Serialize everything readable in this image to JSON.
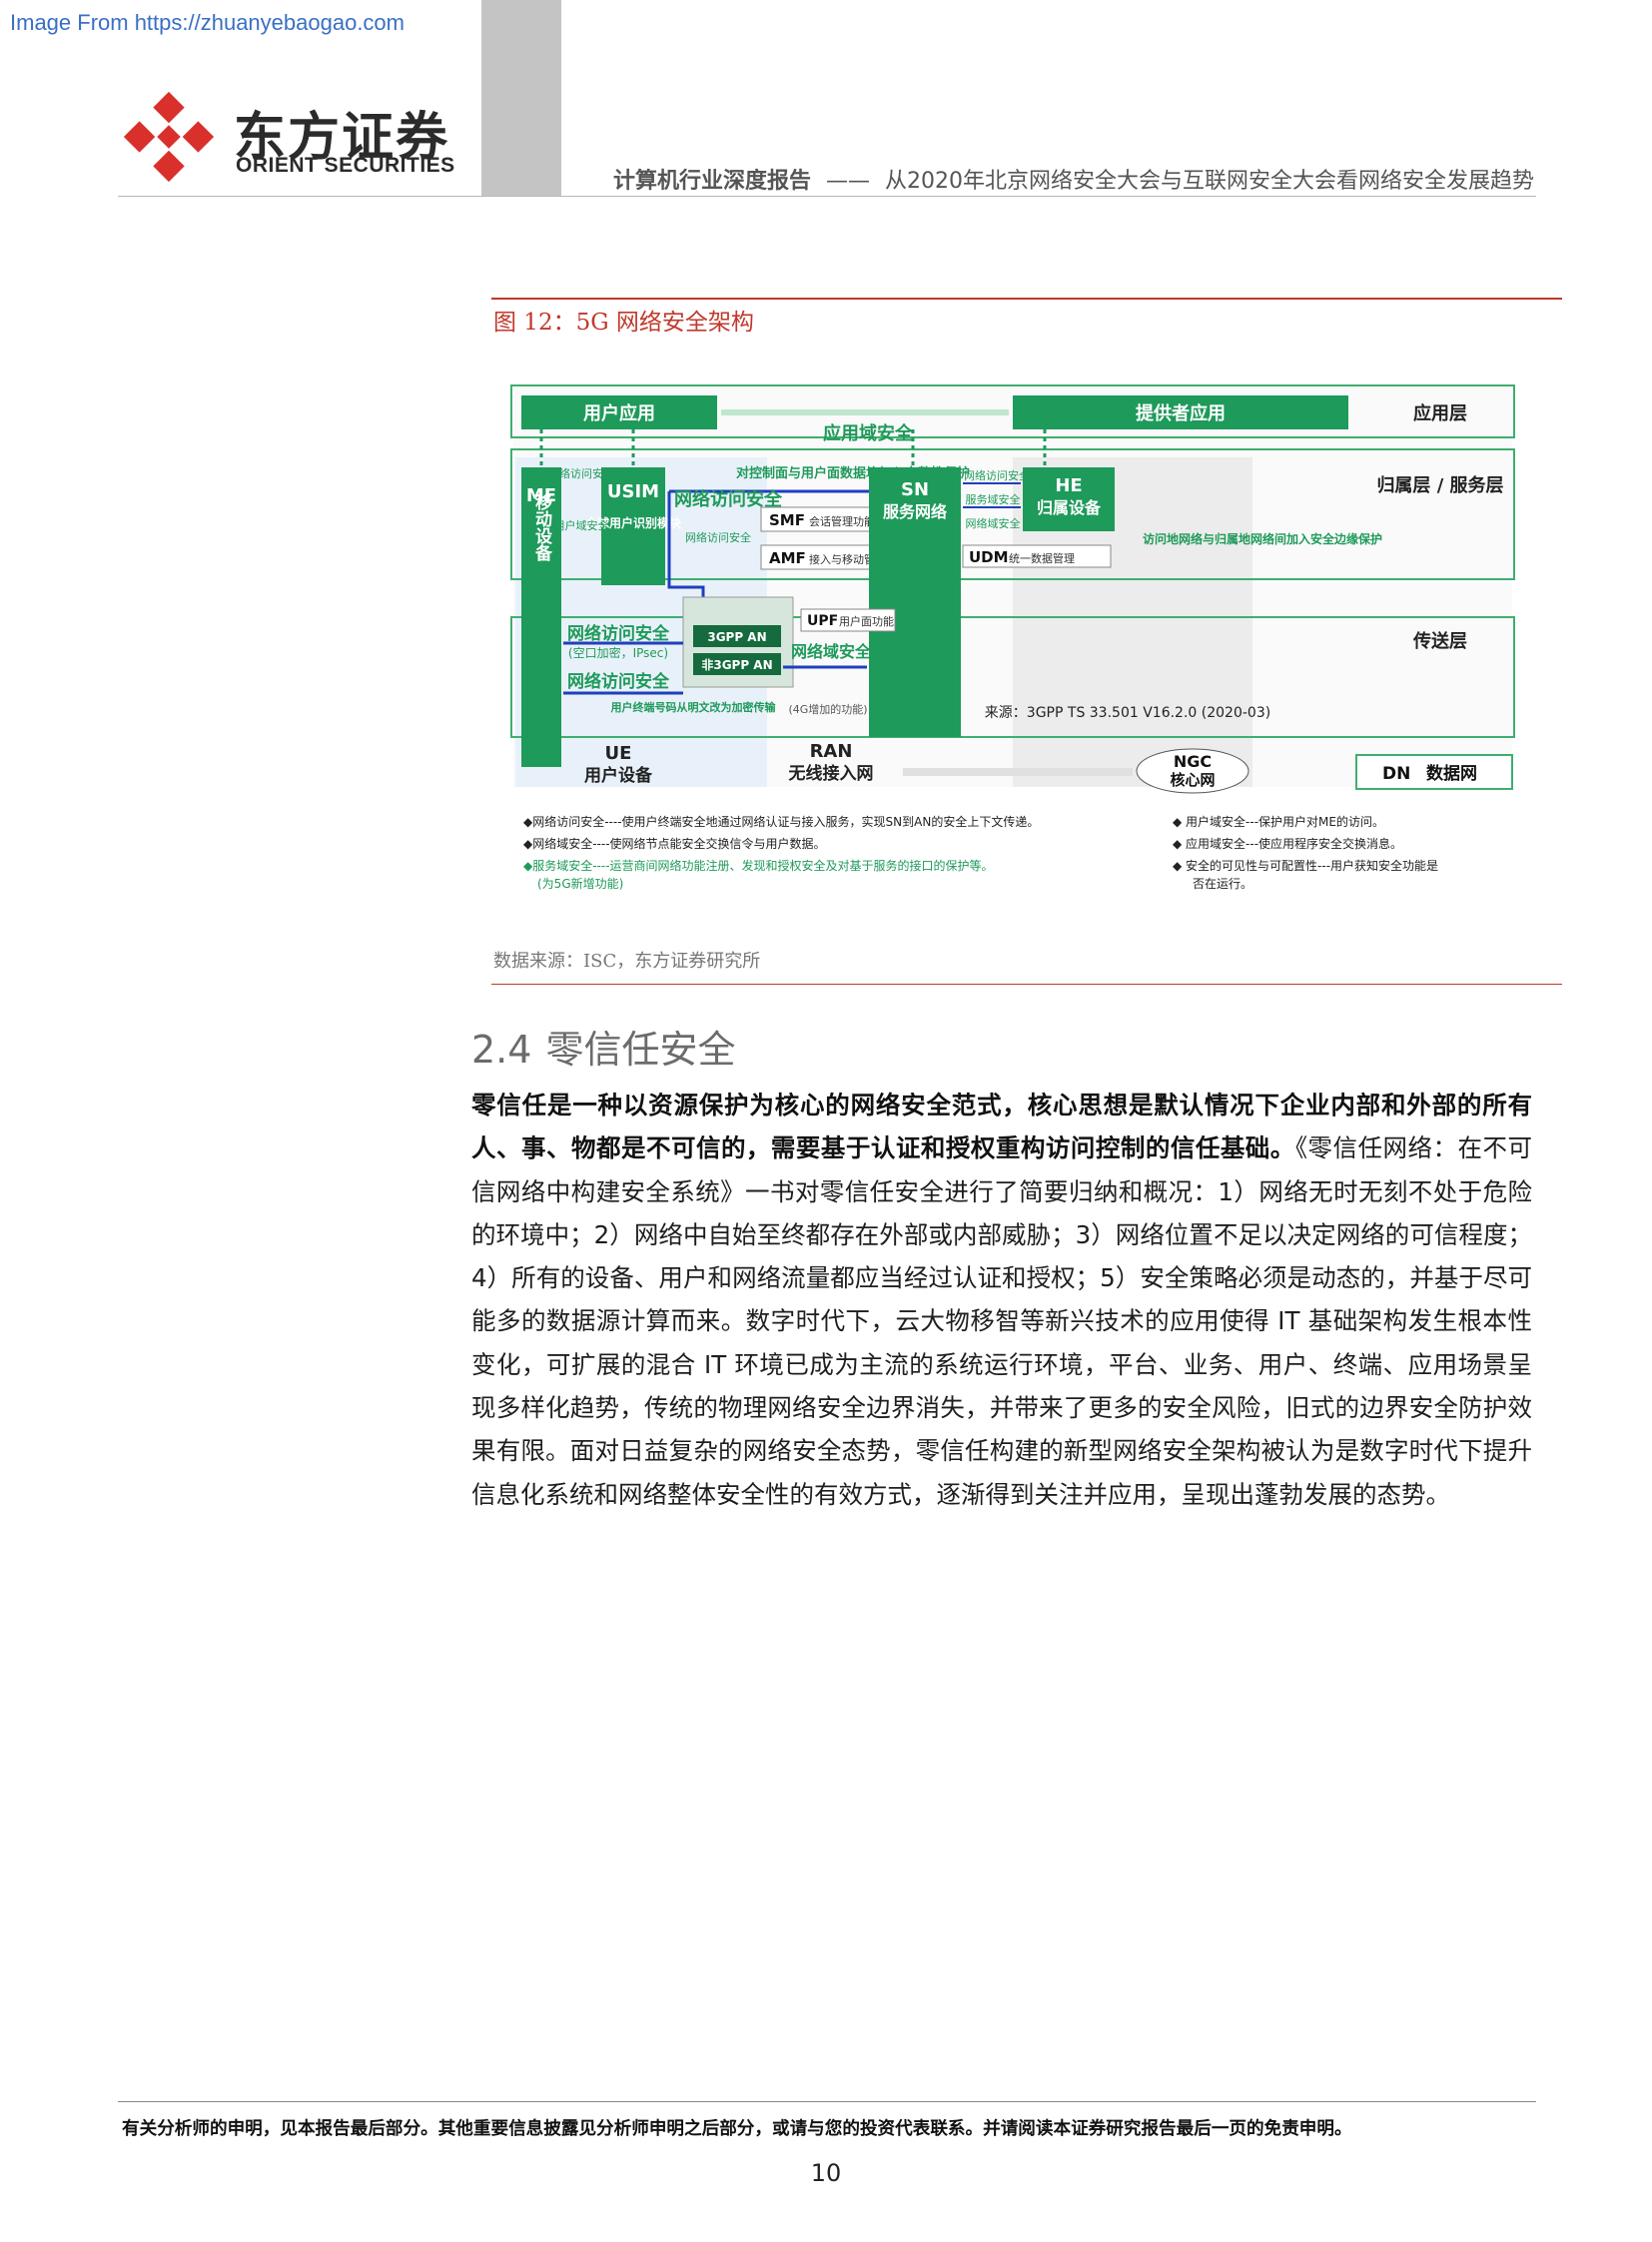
{
  "watermark": "Image From https://zhuanyebaogao.com",
  "logo": {
    "cn": "东方证券",
    "en": "ORIENT SECURITIES"
  },
  "header": {
    "report_type": "计算机行业深度报告",
    "dash": "——",
    "report_title": "从2020年北京网络安全大会与互联网安全大会看网络安全发展趋势"
  },
  "figure": {
    "caption": "图 12：5G 网络安全架构",
    "source": "数据来源：ISC，东方证券研究所",
    "diagram": {
      "user_app": "用户应用",
      "provider_app": "提供者应用",
      "app_domain_security": "应用域安全",
      "layer_app": "应用层",
      "layer_home_service": "归属层 / 服务层",
      "layer_transport": "传送层",
      "me": "ME",
      "me_cn": "移动设备",
      "usim": "USIM",
      "usim_cn": "全球用户识别模块",
      "net_access_sec_small": "网络访问安全",
      "user_domain_sec_small": "用户域安全",
      "integrity_protection": "对控制面与用户面数据均加入完整性保护",
      "net_access_sec": "网络访问安全",
      "smf": "SMF",
      "smf_desc": "会话管理功能",
      "amf": "AMF",
      "amf_desc": "接入与移动管理功能",
      "net_access_sec_ran": "网络访问安全",
      "sn": "SN",
      "sn_cn": "服务网络",
      "he": "HE",
      "he_cn": "归属设备",
      "sn_he_access": "网络访问安全",
      "service_domain": "服务域安全",
      "network_domain": "网络域安全",
      "udm": "UDM",
      "udm_desc": "统一数据管理",
      "roaming_note": "访问地网络与归属地网络间加入安全边缘保护",
      "gpp_an": "3GPP AN",
      "non_gpp_an": "非3GPP AN",
      "upf": "UPF",
      "upf_desc": "用户面功能",
      "net_domain_sec": "网络域安全",
      "air_access": "网络访问安全",
      "air_detail": "(空口加密，IPsec)",
      "air_access2": "网络访问安全",
      "encrypted_note": "用户终端号码从明文改为加密传输",
      "added_4g": "(4G增加的功能)",
      "source_note": "来源：3GPP TS 33.501 V16.2.0 (2020-03)",
      "ue": "UE",
      "ue_cn": "用户设备",
      "ran": "RAN",
      "ran_cn": "无线接入网",
      "ngc": "NGC",
      "ngc_cn": "核心网",
      "dn": "DN",
      "dn_cn": "数据网",
      "legend_left": [
        "◆网络访问安全----使用户终端安全地通过网络认证与接入服务，实现SN到AN的安全上下文传递。",
        "◆网络域安全----使网络节点能安全交换信令与用户数据。",
        "◆服务域安全----运营商间网络功能注册、发现和授权安全及对基于服务的接口的保护等。",
        "(为5G新增功能)"
      ],
      "legend_right": [
        "◆  用户域安全---保护用户对ME的访问。",
        "◆  应用域安全---使应用程序安全交换消息。",
        "◆  安全的可见性与可配置性---用户获知安全功能是",
        "否在运行。"
      ]
    }
  },
  "section": {
    "number": "2.4",
    "title": "零信任安全"
  },
  "body": {
    "bold": "零信任是一种以资源保护为核心的网络安全范式，核心思想是默认情况下企业内部和外部的所有人、事、物都是不可信的，需要基于认证和授权重构访问控制的信任基础。",
    "text": "《零信任网络：在不可信网络中构建安全系统》一书对零信任安全进行了简要归纳和概况：1）网络无时无刻不处于危险的环境中；2）网络中自始至终都存在外部或内部威胁；3）网络位置不足以决定网络的可信程度；4）所有的设备、用户和网络流量都应当经过认证和授权；5）安全策略必须是动态的，并基于尽可能多的数据源计算而来。数字时代下，云大物移智等新兴技术的应用使得 IT 基础架构发生根本性变化，可扩展的混合 IT 环境已成为主流的系统运行环境，平台、业务、用户、终端、应用场景呈现多样化趋势，传统的物理网络安全边界消失，并带来了更多的安全风险，旧式的边界安全防护效果有限。面对日益复杂的网络安全态势，零信任构建的新型网络安全架构被认为是数字时代下提升信息化系统和网络整体安全性的有效方式，逐渐得到关注并应用，呈现出蓬勃发展的态势。"
  },
  "footer": {
    "disclaimer": "有关分析师的申明，见本报告最后部分。其他重要信息披露见分析师申明之后部分，或请与您的投资代表联系。并请阅读本证券研究报告最后一页的免责申明。",
    "page_number": "10"
  },
  "colors": {
    "brand_red": "#d32f2f",
    "accent_red": "#c0392b",
    "diagram_green": "#1e9a5a",
    "arrow_blue": "#1f3fbf"
  }
}
